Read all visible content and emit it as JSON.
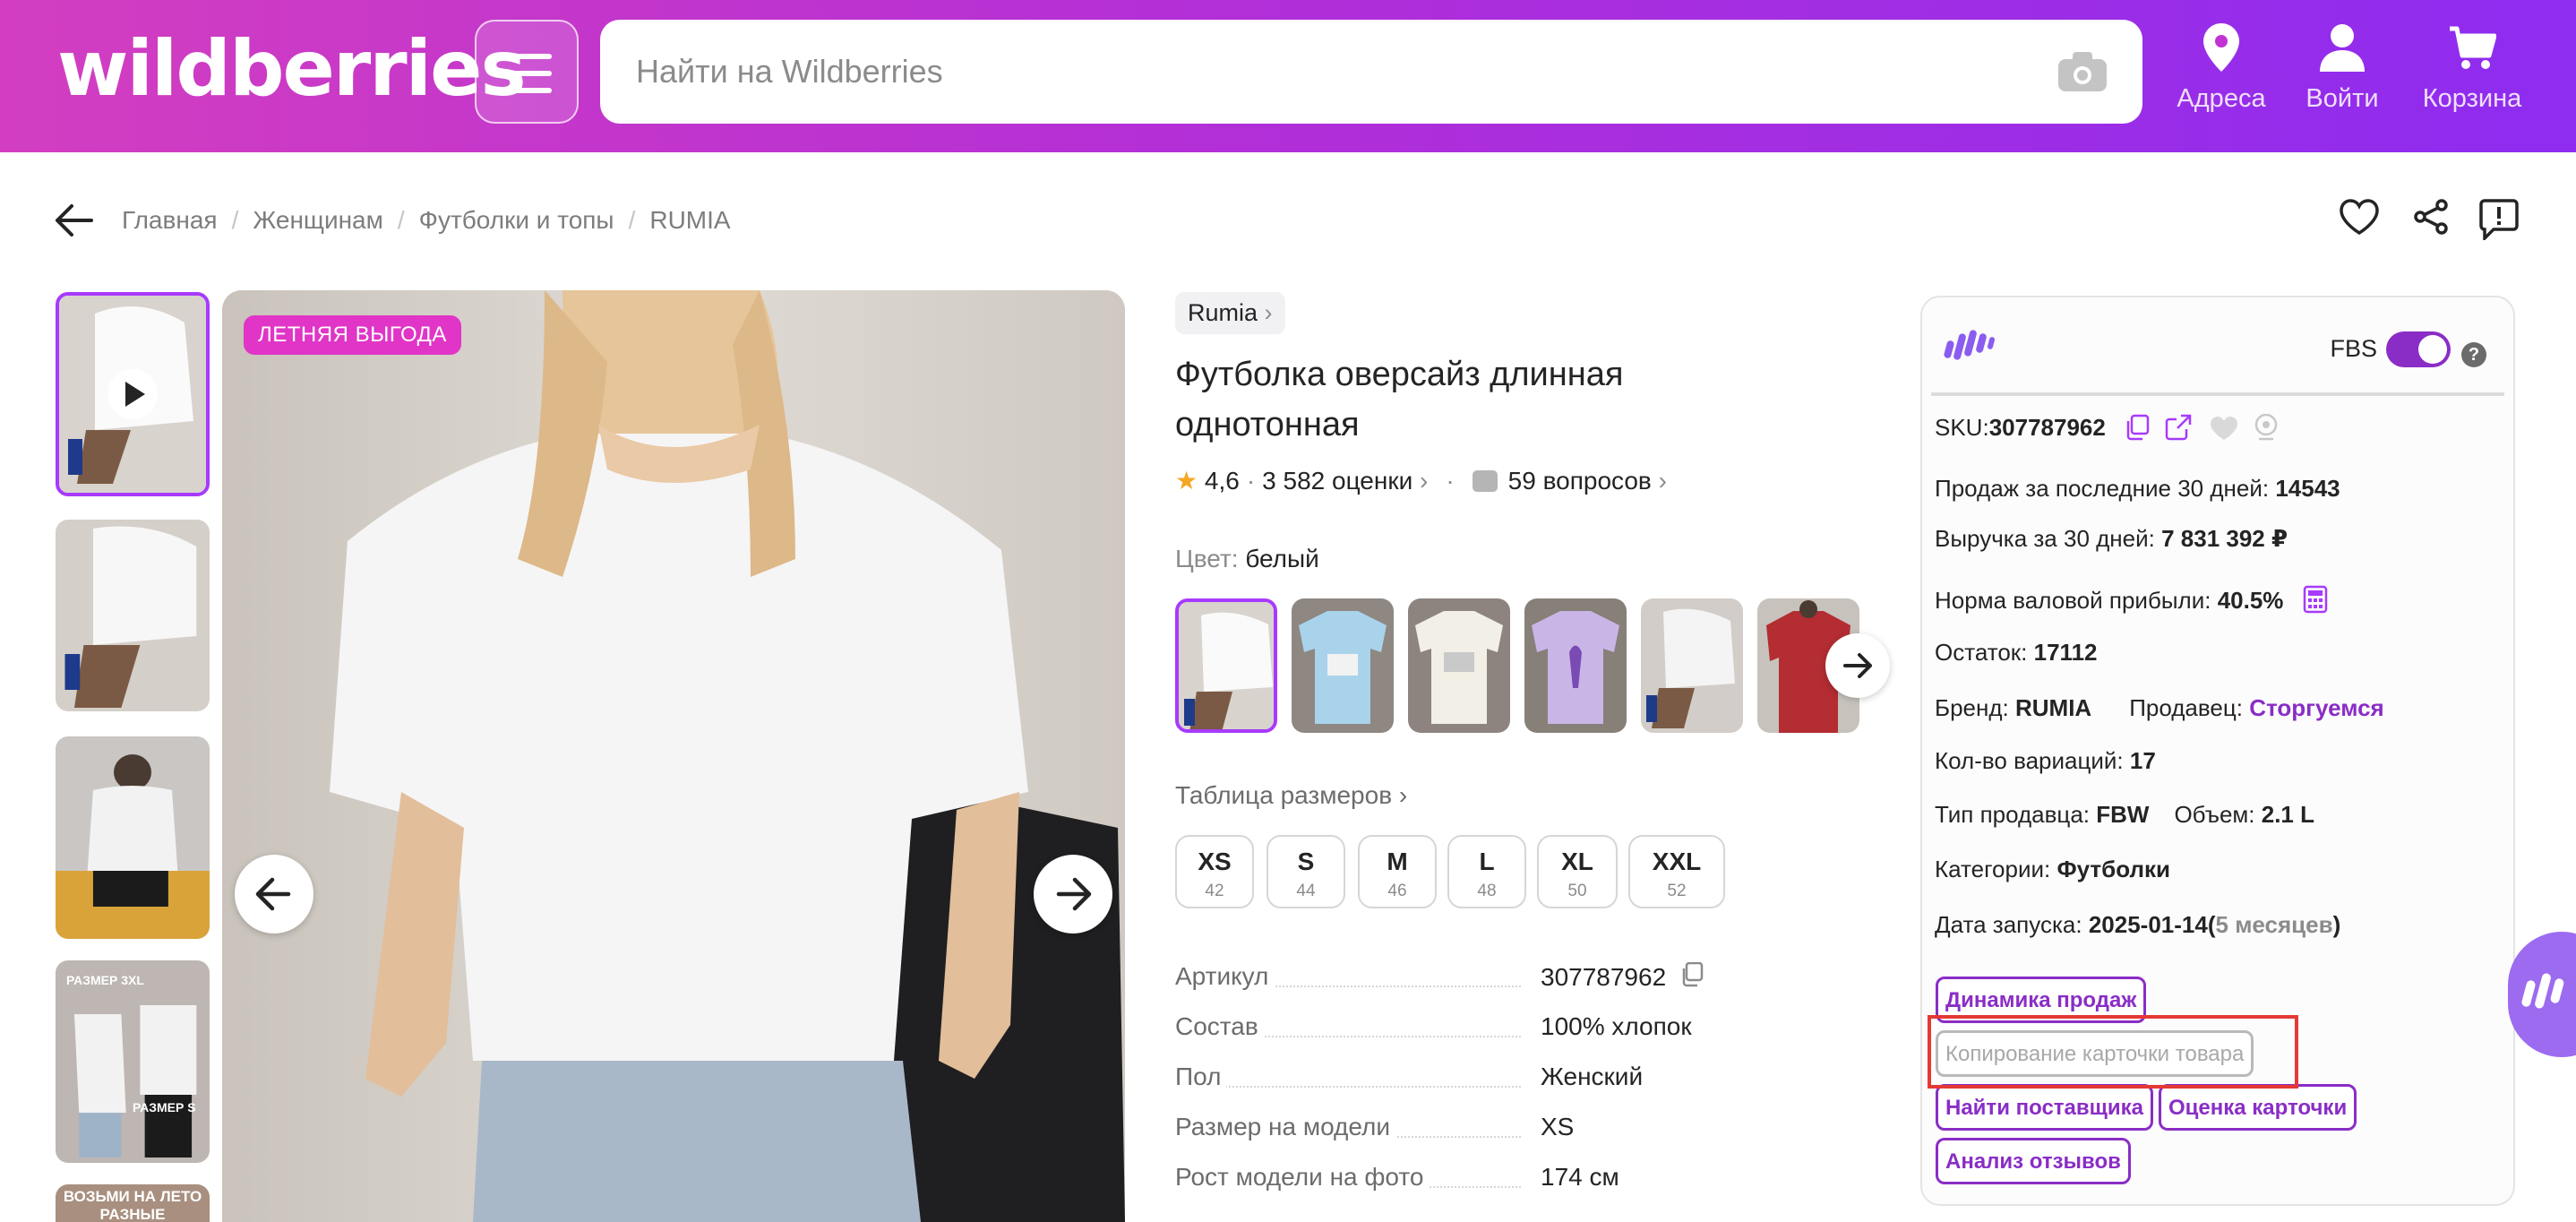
{
  "header": {
    "logo": "wildberries",
    "search_placeholder": "Найти на Wildberries",
    "nav": [
      {
        "label": "Адреса",
        "icon": "location-pin-icon"
      },
      {
        "label": "Войти",
        "icon": "user-icon"
      },
      {
        "label": "Корзина",
        "icon": "cart-icon"
      }
    ]
  },
  "breadcrumbs": [
    "Главная",
    "Женщинам",
    "Футболки и топы",
    "RUMIA"
  ],
  "gallery": {
    "badge": "ЛЕТНЯЯ ВЫГОДА",
    "thumb_texts": {
      "t4_top": "РАЗМЕР 3XL",
      "t4_bottom": "РАЗМЕР S",
      "t5": "ВОЗЬМИ НА ЛЕТО РАЗНЫЕ"
    }
  },
  "product": {
    "brand": "Rumia",
    "title": "Футболка оверсайз длинная однотонная",
    "rating": "4,6",
    "reviews": "3 582 оценки",
    "questions": "59 вопросов",
    "color_label": "Цвет:",
    "color_value": "белый",
    "size_table_link": "Таблица размеров",
    "sizes": [
      {
        "size": "XS",
        "num": "42"
      },
      {
        "size": "S",
        "num": "44"
      },
      {
        "size": "M",
        "num": "46"
      },
      {
        "size": "L",
        "num": "48"
      },
      {
        "size": "XL",
        "num": "50"
      },
      {
        "size": "XXL",
        "num": "52"
      }
    ],
    "specs": [
      {
        "key": "Артикул",
        "value": "307787962"
      },
      {
        "key": "Состав",
        "value": "100% хлопок"
      },
      {
        "key": "Пол",
        "value": "Женский"
      },
      {
        "key": "Размер на модели",
        "value": "XS"
      },
      {
        "key": "Рост модели на фото",
        "value": "174 см"
      }
    ]
  },
  "panel": {
    "fbs_label": "FBS",
    "fbs_enabled": true,
    "help": "?",
    "sku_label": "SKU:",
    "sku": "307787962",
    "sales_30_label": "Продаж за последние 30 дней:",
    "sales_30": "14543",
    "revenue_30_label": "Выручка за 30 дней:",
    "revenue_30": "7 831 392 ₽",
    "margin_label": "Норма валовой прибыли:",
    "margin": "40.5%",
    "stock_label": "Остаток:",
    "stock": "17112",
    "brand_label": "Бренд:",
    "brand": "RUMIA",
    "seller_label": "Продавец:",
    "seller": "Сторгуемся",
    "variants_label": "Кол-во вариаций:",
    "variants": "17",
    "seller_type_label": "Тип продавца:",
    "seller_type": "FBW",
    "volume_label": "Объем:",
    "volume": "2.1 L",
    "category_label": "Категории:",
    "category": "Футболки",
    "launch_label": "Дата запуска:",
    "launch_date": "2025-01-14",
    "launch_age": "5 месяцев",
    "buttons": {
      "sales_dynamics": "Динамика продаж",
      "copy_card": "Копирование карточки товара",
      "find_supplier": "Найти поставщика",
      "rate_card": "Оценка карточки",
      "review_analysis": "Анализ отзывов"
    }
  },
  "colors": {
    "accent": "#a73afd",
    "panel_accent": "#8a2dc6",
    "badge": "#e035c7",
    "highlight": "#e53935",
    "header_from": "#d33ec0",
    "header_to": "#8e2cf0"
  }
}
